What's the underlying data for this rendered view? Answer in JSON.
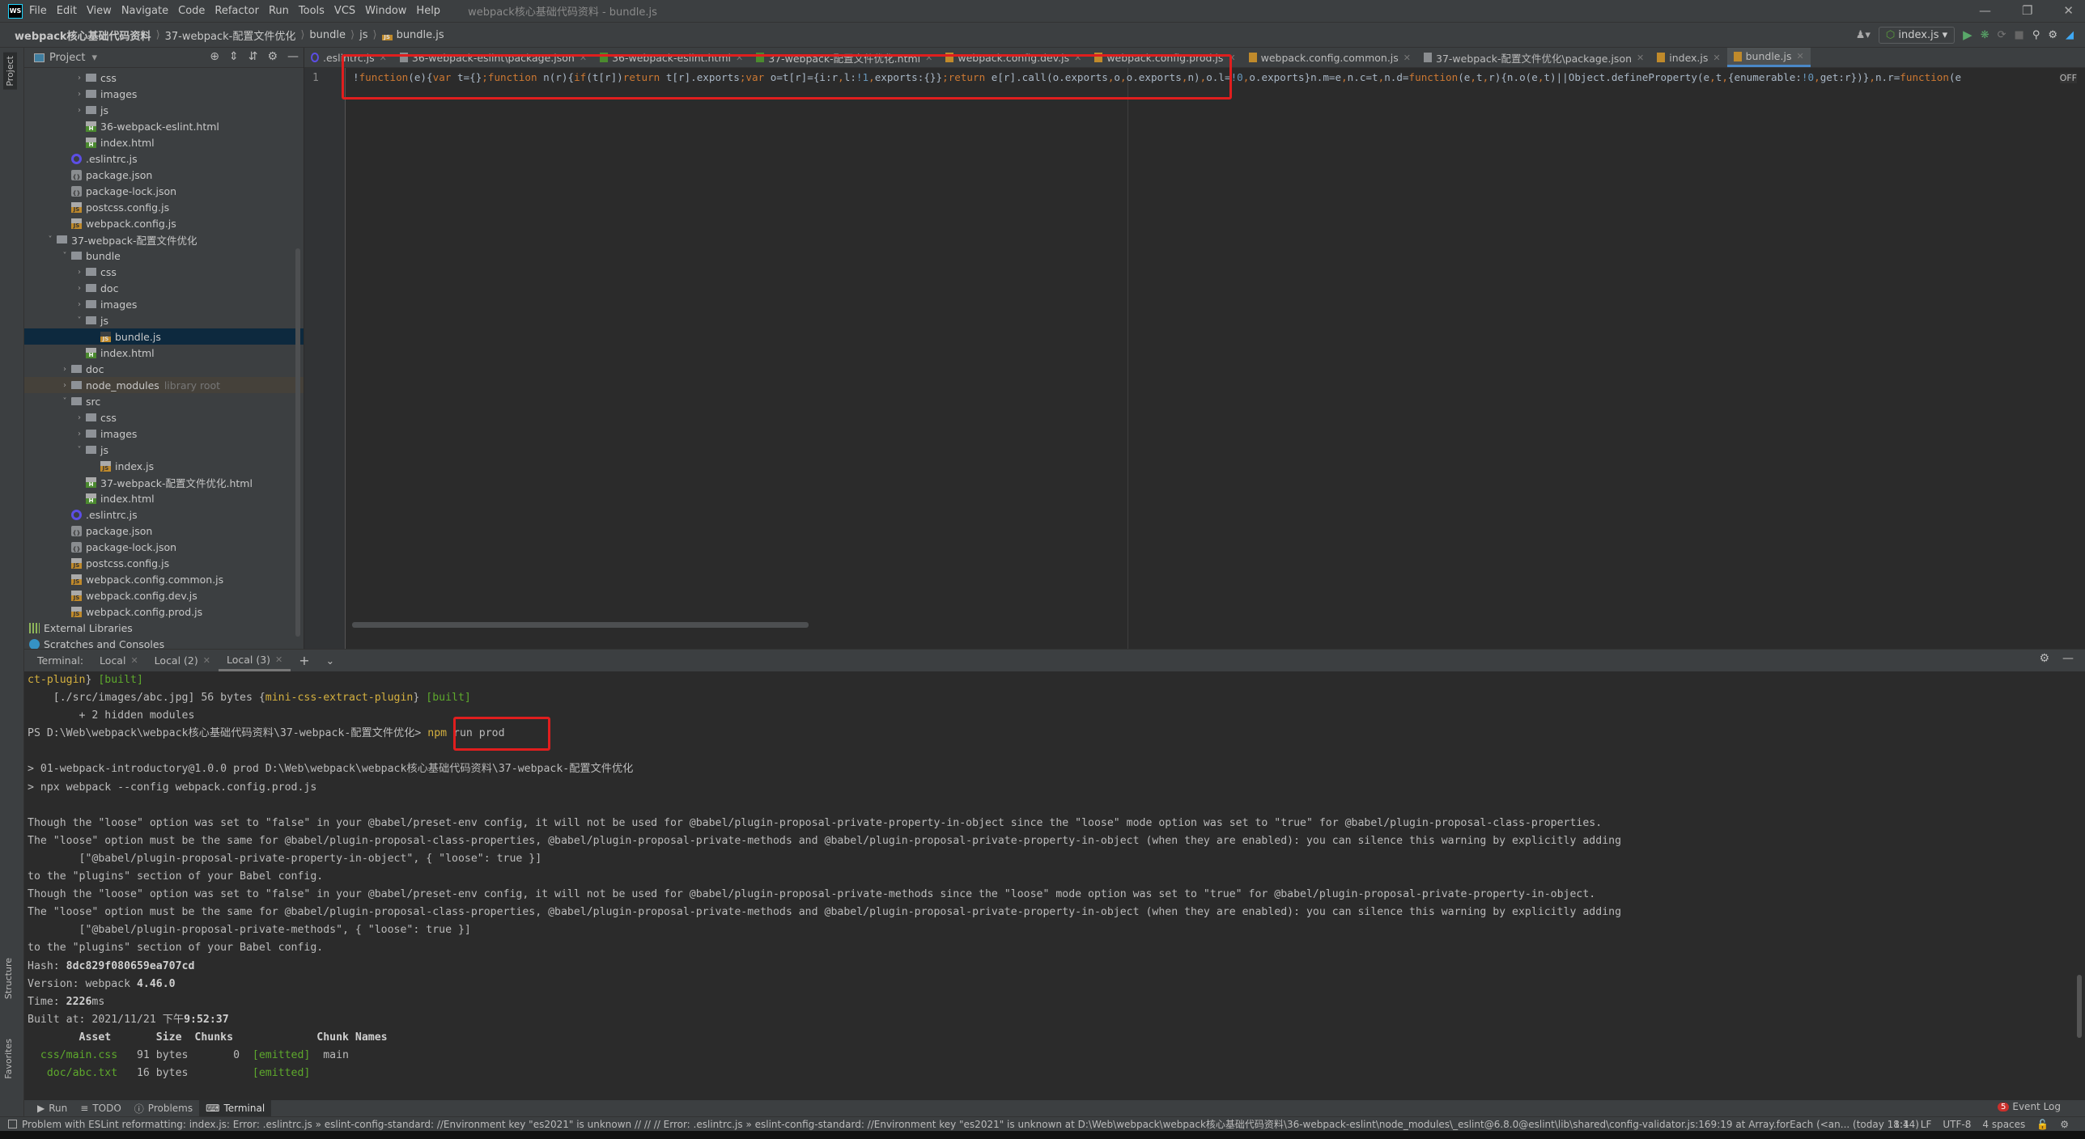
{
  "app": {
    "window_title": "webpack核心基础代码资料 - bundle.js",
    "logo_text": "WS",
    "menu": [
      "File",
      "Edit",
      "View",
      "Navigate",
      "Code",
      "Refactor",
      "Run",
      "Tools",
      "VCS",
      "Window",
      "Help"
    ],
    "window_controls": [
      "minimize",
      "restore",
      "close"
    ]
  },
  "breadcrumb": [
    "webpack核心基础代码资料",
    "37-webpack-配置文件优化",
    "bundle",
    "js",
    "bundle.js"
  ],
  "toolbar": {
    "run_config": "index.js"
  },
  "sidebar": {
    "title": "Project",
    "tree": [
      {
        "label": "css",
        "level": 2,
        "type": "folder",
        "state": "closed"
      },
      {
        "label": "images",
        "level": 2,
        "type": "folder",
        "state": "closed"
      },
      {
        "label": "js",
        "level": 2,
        "type": "folder",
        "state": "closed"
      },
      {
        "label": "36-webpack-eslint.html",
        "level": 2,
        "type": "html"
      },
      {
        "label": "index.html",
        "level": 2,
        "type": "html"
      },
      {
        "label": ".eslintrc.js",
        "level": 1,
        "type": "eslint"
      },
      {
        "label": "package.json",
        "level": 1,
        "type": "json"
      },
      {
        "label": "package-lock.json",
        "level": 1,
        "type": "json"
      },
      {
        "label": "postcss.config.js",
        "level": 1,
        "type": "js"
      },
      {
        "label": "webpack.config.js",
        "level": 1,
        "type": "js"
      },
      {
        "label": "37-webpack-配置文件优化",
        "level": 0,
        "type": "folder",
        "state": "open"
      },
      {
        "label": "bundle",
        "level": 1,
        "type": "folder",
        "state": "open"
      },
      {
        "label": "css",
        "level": 2,
        "type": "folder",
        "state": "closed"
      },
      {
        "label": "doc",
        "level": 2,
        "type": "folder",
        "state": "closed"
      },
      {
        "label": "images",
        "level": 2,
        "type": "folder",
        "state": "closed"
      },
      {
        "label": "js",
        "level": 2,
        "type": "folder",
        "state": "open"
      },
      {
        "label": "bundle.js",
        "level": 3,
        "type": "bundle",
        "selected": true
      },
      {
        "label": "index.html",
        "level": 2,
        "type": "html"
      },
      {
        "label": "doc",
        "level": 1,
        "type": "folder",
        "state": "closed"
      },
      {
        "label": "node_modules",
        "level": 1,
        "type": "folder",
        "state": "closed",
        "tag": "library root"
      },
      {
        "label": "src",
        "level": 1,
        "type": "folder",
        "state": "open"
      },
      {
        "label": "css",
        "level": 2,
        "type": "folder",
        "state": "closed"
      },
      {
        "label": "images",
        "level": 2,
        "type": "folder",
        "state": "closed"
      },
      {
        "label": "js",
        "level": 2,
        "type": "folder",
        "state": "open"
      },
      {
        "label": "index.js",
        "level": 3,
        "type": "js"
      },
      {
        "label": "37-webpack-配置文件优化.html",
        "level": 2,
        "type": "html"
      },
      {
        "label": "index.html",
        "level": 2,
        "type": "html"
      },
      {
        "label": ".eslintrc.js",
        "level": 1,
        "type": "eslint"
      },
      {
        "label": "package.json",
        "level": 1,
        "type": "json"
      },
      {
        "label": "package-lock.json",
        "level": 1,
        "type": "json"
      },
      {
        "label": "postcss.config.js",
        "level": 1,
        "type": "js"
      },
      {
        "label": "webpack.config.common.js",
        "level": 1,
        "type": "js"
      },
      {
        "label": "webpack.config.dev.js",
        "level": 1,
        "type": "js"
      },
      {
        "label": "webpack.config.prod.js",
        "level": 1,
        "type": "js"
      },
      {
        "label": "External Libraries",
        "level": -1,
        "type": "ext"
      },
      {
        "label": "Scratches and Consoles",
        "level": -1,
        "type": "scratch"
      }
    ]
  },
  "left_strip": {
    "project": "Project",
    "structure": "Structure",
    "favorites": "Favorites"
  },
  "editor": {
    "tabs": [
      {
        "label": ".eslintrc.js",
        "type": "eslint"
      },
      {
        "label": "36-webpack-eslint\\package.json",
        "type": "json"
      },
      {
        "label": "36-webpack-eslint.html",
        "type": "html"
      },
      {
        "label": "37-webpack-配置文件优化.html",
        "type": "html"
      },
      {
        "label": "webpack.config.dev.js",
        "type": "js"
      },
      {
        "label": "webpack.config.prod.js",
        "type": "js"
      },
      {
        "label": "webpack.config.common.js",
        "type": "js"
      },
      {
        "label": "37-webpack-配置文件优化\\package.json",
        "type": "json"
      },
      {
        "label": "index.js",
        "type": "js"
      },
      {
        "label": "bundle.js",
        "type": "bundle",
        "active": true
      }
    ],
    "line_number": "1",
    "code_segments": [
      [
        "!",
        "d"
      ],
      [
        "function",
        "k"
      ],
      [
        "(e){",
        "d"
      ],
      [
        "var ",
        "k"
      ],
      [
        "t={}",
        "d"
      ],
      [
        ";",
        "k"
      ],
      [
        "function ",
        "k"
      ],
      [
        "n(r){",
        "d"
      ],
      [
        "if",
        "k"
      ],
      [
        "(t[r])",
        "d"
      ],
      [
        "return ",
        "k"
      ],
      [
        "t[r].exports",
        "d"
      ],
      [
        ";",
        "k"
      ],
      [
        "var ",
        "k"
      ],
      [
        "o=t[r]={i:r",
        "d"
      ],
      [
        ",",
        "k"
      ],
      [
        "l:",
        "d"
      ],
      [
        "!1",
        "n"
      ],
      [
        ",",
        "k"
      ],
      [
        "exports:{}}",
        "d"
      ],
      [
        ";",
        "k"
      ],
      [
        "return ",
        "k"
      ],
      [
        "e[r].call(o.exports",
        "d"
      ],
      [
        ",",
        "k"
      ],
      [
        "o",
        "d"
      ],
      [
        ",",
        "k"
      ],
      [
        "o.exports",
        "d"
      ],
      [
        ",",
        "k"
      ],
      [
        "n)",
        "d"
      ],
      [
        ",",
        "k"
      ],
      [
        "o.l=",
        "d"
      ],
      [
        "!0",
        "n"
      ],
      [
        ",",
        "k"
      ],
      [
        "o.exports}",
        "d"
      ],
      [
        "n.m=e",
        "d"
      ],
      [
        ",",
        "k"
      ],
      [
        "n.c=t",
        "d"
      ],
      [
        ",",
        "k"
      ],
      [
        "n.d=",
        "d"
      ],
      [
        "function",
        "k"
      ],
      [
        "(e",
        "d"
      ],
      [
        ",",
        "k"
      ],
      [
        "t",
        "d"
      ],
      [
        ",",
        "k"
      ],
      [
        "r){n.o(e",
        "d"
      ],
      [
        ",",
        "k"
      ],
      [
        "t)||Object.defineProperty(e",
        "d"
      ],
      [
        ",",
        "k"
      ],
      [
        "t",
        "d"
      ],
      [
        ",",
        "k"
      ],
      [
        "{enumerable:",
        "d"
      ],
      [
        "!0",
        "n"
      ],
      [
        ",",
        "k"
      ],
      [
        "get:r})}",
        "d"
      ],
      [
        ",",
        "k"
      ],
      [
        "n.r=",
        "d"
      ],
      [
        "function",
        "k"
      ],
      [
        "(e",
        "d"
      ]
    ],
    "status_badge": "OFF"
  },
  "terminal": {
    "label": "Terminal:",
    "tabs": [
      {
        "label": "Local"
      },
      {
        "label": "Local (2)"
      },
      {
        "label": "Local (3)",
        "active": true
      }
    ],
    "lines": [
      [
        [
          "ct-plugin",
          "y"
        ],
        [
          "} ",
          ""
        ],
        [
          "[built]",
          "g"
        ]
      ],
      [
        [
          "    [./src/images/abc.jpg] 56 bytes {",
          ""
        ],
        [
          "mini-css-extract-plugin",
          "y"
        ],
        [
          "} ",
          ""
        ],
        [
          "[built]",
          "g"
        ]
      ],
      [
        [
          "        + 2 hidden modules",
          ""
        ]
      ],
      [
        [
          "PS D:\\Web\\webpack\\webpack核心基础代码资料\\37-webpack-配置文件优化> ",
          ""
        ],
        [
          "npm",
          "y"
        ],
        [
          " run prod",
          ""
        ]
      ],
      [],
      [
        [
          "> 01-webpack-introductory@1.0.0 prod D:\\Web\\webpack\\webpack核心基础代码资料\\37-webpack-配置文件优化",
          ""
        ]
      ],
      [
        [
          "> npx webpack --config webpack.config.prod.js",
          ""
        ]
      ],
      [],
      [
        [
          "Though the \"loose\" option was set to \"false\" in your @babel/preset-env config, it will not be used for @babel/plugin-proposal-private-property-in-object since the \"loose\" mode option was set to \"true\" for @babel/plugin-proposal-class-properties.",
          ""
        ]
      ],
      [
        [
          "The \"loose\" option must be the same for @babel/plugin-proposal-class-properties, @babel/plugin-proposal-private-methods and @babel/plugin-proposal-private-property-in-object (when they are enabled): you can silence this warning by explicitly adding",
          ""
        ]
      ],
      [
        [
          "        [\"@babel/plugin-proposal-private-property-in-object\", { \"loose\": true }]",
          ""
        ]
      ],
      [
        [
          "to the \"plugins\" section of your Babel config.",
          ""
        ]
      ],
      [
        [
          "Though the \"loose\" option was set to \"false\" in your @babel/preset-env config, it will not be used for @babel/plugin-proposal-private-methods since the \"loose\" mode option was set to \"true\" for @babel/plugin-proposal-private-property-in-object.",
          ""
        ]
      ],
      [
        [
          "The \"loose\" option must be the same for @babel/plugin-proposal-class-properties, @babel/plugin-proposal-private-methods and @babel/plugin-proposal-private-property-in-object (when they are enabled): you can silence this warning by explicitly adding",
          ""
        ]
      ],
      [
        [
          "        [\"@babel/plugin-proposal-private-methods\", { \"loose\": true }]",
          ""
        ]
      ],
      [
        [
          "to the \"plugins\" section of your Babel config.",
          ""
        ]
      ],
      [
        [
          "Hash: ",
          ""
        ],
        [
          "8dc829f080659ea707cd",
          "bd"
        ]
      ],
      [
        [
          "Version: webpack ",
          ""
        ],
        [
          "4.46.0",
          "bd"
        ]
      ],
      [
        [
          "Time: ",
          ""
        ],
        [
          "2226",
          "bd"
        ],
        [
          "ms",
          ""
        ]
      ],
      [
        [
          "Built at: 2021/11/21 下午",
          ""
        ],
        [
          "9:52:37",
          "bd"
        ]
      ],
      [
        [
          "        Asset       Size  Chunks             Chunk Names",
          "bd"
        ]
      ],
      [
        [
          "  css/main.css",
          "g"
        ],
        [
          "   91 bytes       0  ",
          ""
        ],
        [
          "[emitted]",
          "g"
        ],
        [
          "  main",
          ""
        ]
      ],
      [
        [
          "   doc/abc.txt",
          "g"
        ],
        [
          "   16 bytes          ",
          ""
        ],
        [
          "[emitted]",
          "g"
        ]
      ]
    ]
  },
  "tool_windows": [
    {
      "label": "Run",
      "icon": "play-icon"
    },
    {
      "label": "TODO",
      "icon": "list-icon"
    },
    {
      "label": "Problems",
      "icon": "warning-icon"
    },
    {
      "label": "Terminal",
      "icon": "terminal-icon",
      "active": true
    }
  ],
  "event_log": {
    "count": "5",
    "label": "Event Log"
  },
  "status_bar": {
    "message": "Problem with ESLint reformatting: index.js: Error: .eslintrc.js » eslint-config-standard: //Environment key \"es2021\" is unknown // // // Error: .eslintrc.js » eslint-config-standard: //Environment key \"es2021\" is unknown    at D:\\Web\\webpack\\webpack核心基础代码资料\\36-webpack-eslint\\node_modules\\_eslint@6.8.0@eslint\\lib\\shared\\config-validator.js:169:19    at Array.forEach (<an... (today 18:44)",
    "position": "1:1",
    "line_ending": "LF",
    "encoding": "UTF-8",
    "indent": "4 spaces"
  },
  "colors": {
    "accent": "#4a88c7",
    "annotation": "#e01e1e",
    "keyword": "#cc7832",
    "number": "#6897bb",
    "terminal_yellow": "#d4b03f",
    "terminal_green": "#5ea92c"
  }
}
